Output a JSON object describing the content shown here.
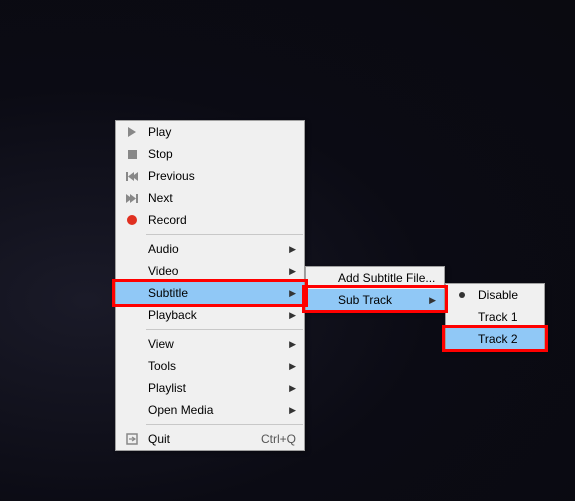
{
  "main": {
    "play": "Play",
    "stop": "Stop",
    "previous": "Previous",
    "next": "Next",
    "record": "Record",
    "audio": "Audio",
    "video": "Video",
    "subtitle": "Subtitle",
    "playback": "Playback",
    "view": "View",
    "tools": "Tools",
    "playlist": "Playlist",
    "open_media": "Open Media",
    "quit": "Quit",
    "quit_shortcut": "Ctrl+Q"
  },
  "sub1": {
    "add_file": "Add Subtitle File...",
    "sub_track": "Sub Track"
  },
  "sub2": {
    "disable": "Disable",
    "track1": "Track 1",
    "track2": "Track 2"
  }
}
